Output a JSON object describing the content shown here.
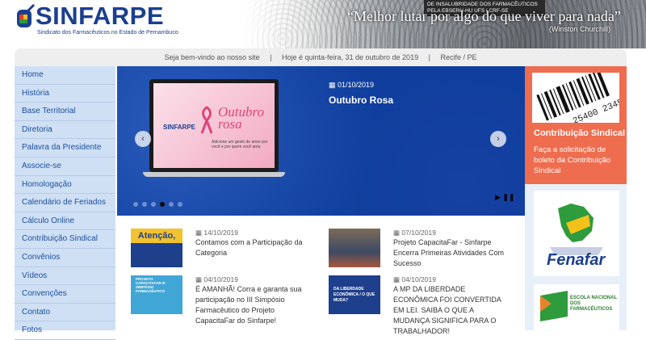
{
  "header": {
    "logo_title": "SINFARPE",
    "logo_subtitle": "Sindicato dos Farmacêuticos no Estado de Pernambuco",
    "banner_box": "DE INSALUBRIDADE DOS FARMACÊUTICOS PELA EBSERH-HU UFS | CRF-SE",
    "banner_quote": "“Melhor lutar por algo do que viver para nada”",
    "banner_author": "(Winston Churchill)"
  },
  "infobar": {
    "welcome": "Seja bem-vindo ao nosso site",
    "sep1": "|",
    "today": "Hoje é quinta-feira, 31 de outubro de 2019",
    "sep2": "|",
    "location": "Recife / PE"
  },
  "sidebar": {
    "items": [
      {
        "label": "Home"
      },
      {
        "label": "História"
      },
      {
        "label": "Base Territorial"
      },
      {
        "label": "Diretoria"
      },
      {
        "label": "Palavra da Presidente"
      },
      {
        "label": "Associe-se"
      },
      {
        "label": "Homologação"
      },
      {
        "label": "Calendário de Feriados"
      },
      {
        "label": "Cálculo Online"
      },
      {
        "label": "Contribuição Sindical"
      },
      {
        "label": "Convênios"
      },
      {
        "label": "Vídeos"
      },
      {
        "label": "Convenções"
      },
      {
        "label": "Contato"
      },
      {
        "label": "Fotos"
      }
    ]
  },
  "slider": {
    "date": "01/10/2019",
    "title": "Outubro Rosa",
    "slide_logo": "SINFARPE",
    "slide_heading_1": "Outubro",
    "slide_heading_2": "rosa",
    "slide_caption": "Adicione um gesto de amor por você e por quem você ama",
    "prev": "‹",
    "next": "›",
    "dot_count": 6,
    "active_dot": 4,
    "controls": "▶ ❚❚"
  },
  "news": [
    {
      "date": "14/10/2019",
      "title": "Contamos com a Participação da Categoria",
      "thumb_text": "Atenção,"
    },
    {
      "date": "07/10/2019",
      "title": "Projeto CapacitaFar - Sinfarpe Encerra Primeiras Atividades Com Sucesso",
      "thumb_text": ""
    },
    {
      "date": "04/10/2019",
      "title": "É AMANHÃ! Corra e garanta sua participação no III Simpósio Farmacêutico do Projeto CapacitaFar do Sinfarpe!",
      "thumb_text": "PROJETO CAPACITAFAR III SIMPÓSIO FARMACÊUTICO"
    },
    {
      "date": "04/10/2019",
      "title": "A MP DA LIBERDADE ECONÔMICA FOI CONVERTIDA EM LEI. SAIBA O QUE A MUDANÇA SIGNIFICA PARA O TRABALHADOR!",
      "thumb_text": "DA LIBERDADE ECONÔMICA / O QUE MUDA?"
    }
  ],
  "rightcol": {
    "barcode_digits": "25400 2345",
    "contrib_title": "Contribuição Sindical",
    "contrib_text": "Faça a solicitação de boleto da Contribuição Sindical",
    "fenafar": "Fenafar",
    "escola": "ESCOLA NACIONAL DOS FARMACÊUTICOS"
  },
  "colors": {
    "brand_blue": "#1b3f8f",
    "slider_bg": "#0c3c9a",
    "sidebar_bg": "#cfe0f5",
    "contrib_bg": "#ee6d4f"
  }
}
